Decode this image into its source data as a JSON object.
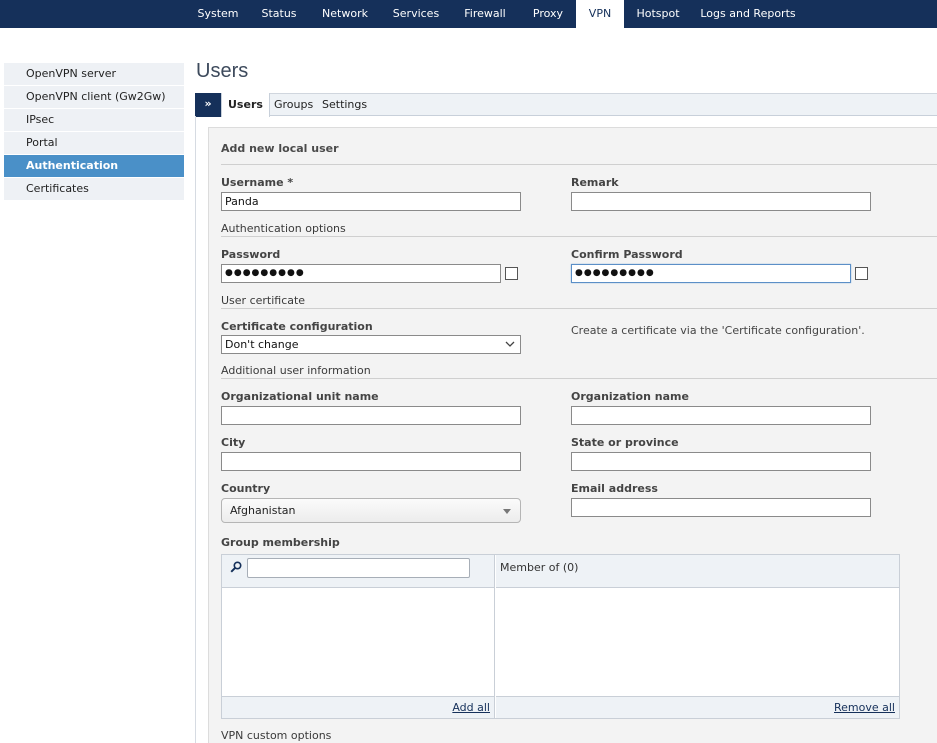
{
  "topnav": {
    "items": [
      {
        "label": "System"
      },
      {
        "label": "Status"
      },
      {
        "label": "Network"
      },
      {
        "label": "Services"
      },
      {
        "label": "Firewall"
      },
      {
        "label": "Proxy"
      },
      {
        "label": "VPN",
        "active": true
      },
      {
        "label": "Hotspot"
      },
      {
        "label": "Logs and Reports"
      }
    ]
  },
  "sidebar": {
    "items": [
      {
        "label": "OpenVPN server"
      },
      {
        "label": "OpenVPN client (Gw2Gw)"
      },
      {
        "label": "IPsec"
      },
      {
        "label": "Portal"
      },
      {
        "label": "Authentication",
        "active": true
      },
      {
        "label": "Certificates"
      }
    ]
  },
  "page": {
    "title": "Users"
  },
  "tabs": {
    "toggle": "»",
    "items": [
      {
        "label": "Users",
        "active": true
      },
      {
        "label": "Groups"
      },
      {
        "label": "Settings"
      }
    ]
  },
  "form": {
    "heading": "Add new local user",
    "username": {
      "label": "Username *",
      "value": "Panda"
    },
    "remark": {
      "label": "Remark",
      "value": ""
    },
    "auth_section": "Authentication options",
    "password": {
      "label": "Password",
      "value": "●●●●●●●●●"
    },
    "confirm_password": {
      "label": "Confirm Password",
      "value": "●●●●●●●●●"
    },
    "cert_section": "User certificate",
    "cert_config": {
      "label": "Certificate configuration",
      "value": "Don't change"
    },
    "cert_note": "Create a certificate via the 'Certificate configuration'.",
    "additional_section": "Additional user information",
    "org_unit": {
      "label": "Organizational unit name",
      "value": ""
    },
    "org_name": {
      "label": "Organization name",
      "value": ""
    },
    "city": {
      "label": "City",
      "value": ""
    },
    "state": {
      "label": "State or province",
      "value": ""
    },
    "country": {
      "label": "Country",
      "value": "Afghanistan"
    },
    "email": {
      "label": "Email address",
      "value": ""
    },
    "group_membership": {
      "label": "Group membership",
      "member_of": "Member of  (0)",
      "add_all": "Add all",
      "remove_all": "Remove all"
    },
    "vpn_section": "VPN custom options"
  },
  "colors": {
    "nav_bg": "#15305a",
    "active_sidebar": "#4a90c8"
  }
}
